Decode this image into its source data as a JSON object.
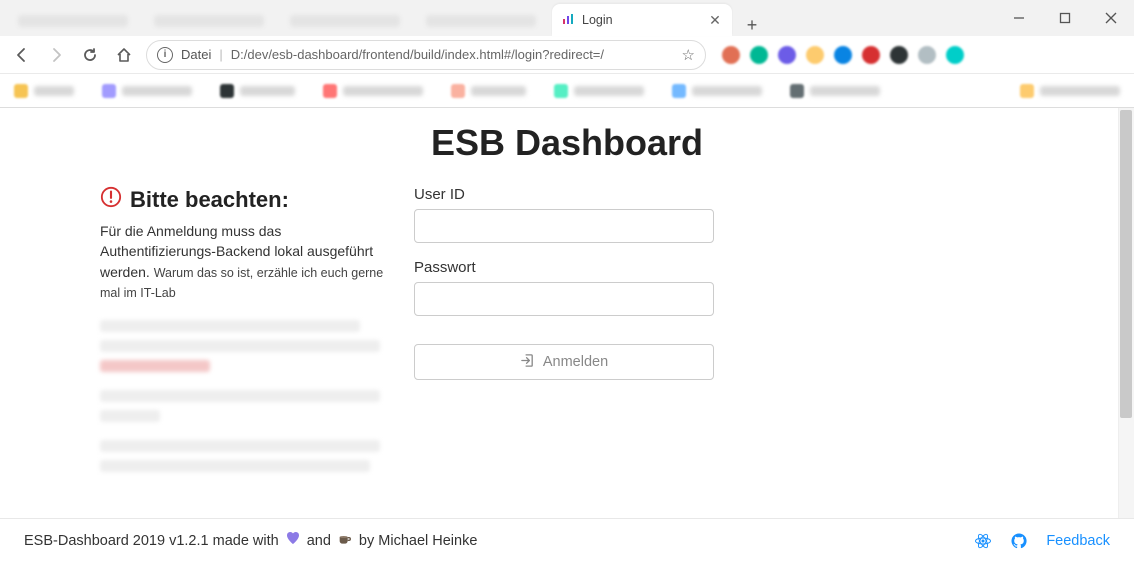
{
  "browser": {
    "tab_title": "Login",
    "url_prefix": "Datei",
    "url": "D:/dev/esb-dashboard/frontend/build/index.html#/login?redirect=/"
  },
  "page": {
    "title": "ESB Dashboard"
  },
  "notice": {
    "heading": "Bitte beachten:",
    "body_main": "Für die Anmeldung muss das Authentifizierungs-Backend lokal ausgeführt werden. ",
    "body_small": "Warum das so ist, erzähle ich euch gerne mal im IT-Lab"
  },
  "form": {
    "user_id_label": "User ID",
    "password_label": "Passwort",
    "submit_label": "Anmelden"
  },
  "footer": {
    "prefix": "ESB-Dashboard 2019 v1.2.1 made with",
    "mid": "and",
    "suffix": "by Michael Heinke",
    "feedback": "Feedback"
  }
}
